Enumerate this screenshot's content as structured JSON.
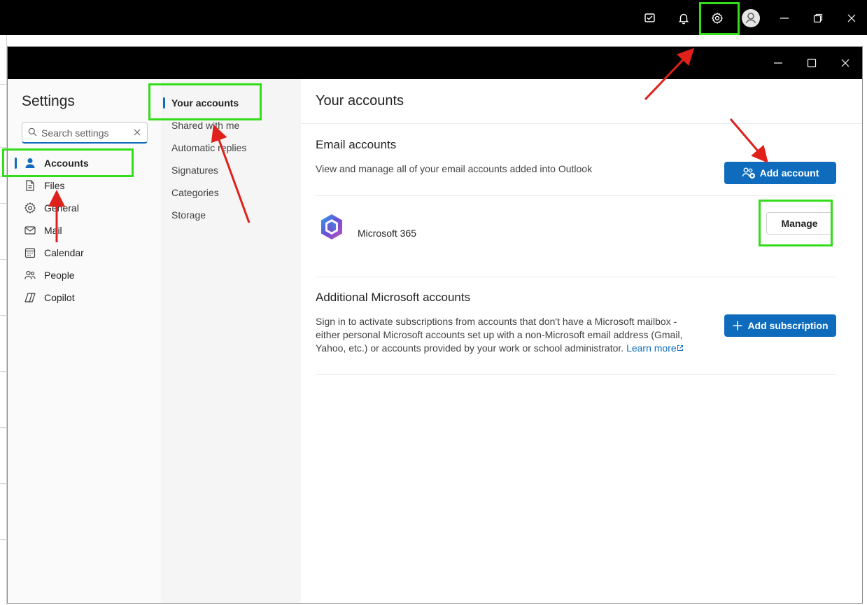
{
  "app": {
    "topbar": {
      "icons": [
        "tasks-icon",
        "bell-icon",
        "gear-icon",
        "avatar-icon",
        "minimize-icon",
        "restore-icon",
        "close-icon"
      ]
    }
  },
  "dialog": {
    "nav": {
      "title": "Settings",
      "search_placeholder": "Search settings",
      "items": [
        {
          "label": "Accounts",
          "icon": "person-icon",
          "active": true
        },
        {
          "label": "Files",
          "icon": "file-icon"
        },
        {
          "label": "General",
          "icon": "gear-icon"
        },
        {
          "label": "Mail",
          "icon": "mail-icon"
        },
        {
          "label": "Calendar",
          "icon": "calendar-icon"
        },
        {
          "label": "People",
          "icon": "people-icon"
        },
        {
          "label": "Copilot",
          "icon": "copilot-icon"
        }
      ]
    },
    "subnav": {
      "items": [
        {
          "label": "Your accounts",
          "active": true
        },
        {
          "label": "Shared with me"
        },
        {
          "label": "Automatic replies"
        },
        {
          "label": "Signatures"
        },
        {
          "label": "Categories"
        },
        {
          "label": "Storage"
        }
      ]
    },
    "content": {
      "title": "Your accounts",
      "email_section": {
        "title": "Email accounts",
        "description": "View and manage all of your email accounts added into Outlook",
        "add_button": "Add account",
        "account_name": "Microsoft 365",
        "manage_button": "Manage"
      },
      "additional_section": {
        "title": "Additional Microsoft accounts",
        "description_lines": [
          "Sign in to activate subscriptions from accounts that don't have a Microsoft mailbox -",
          "either personal Microsoft accounts set up with a non-Microsoft email address (Gmail,",
          "Yahoo, etc.) or accounts provided by your work or school administrator."
        ],
        "learn_more": "Learn more",
        "add_button": "Add subscription"
      }
    }
  },
  "colors": {
    "accent": "#0f6cbd",
    "highlight": "#33dd1a",
    "arrow": "#e0201b"
  }
}
